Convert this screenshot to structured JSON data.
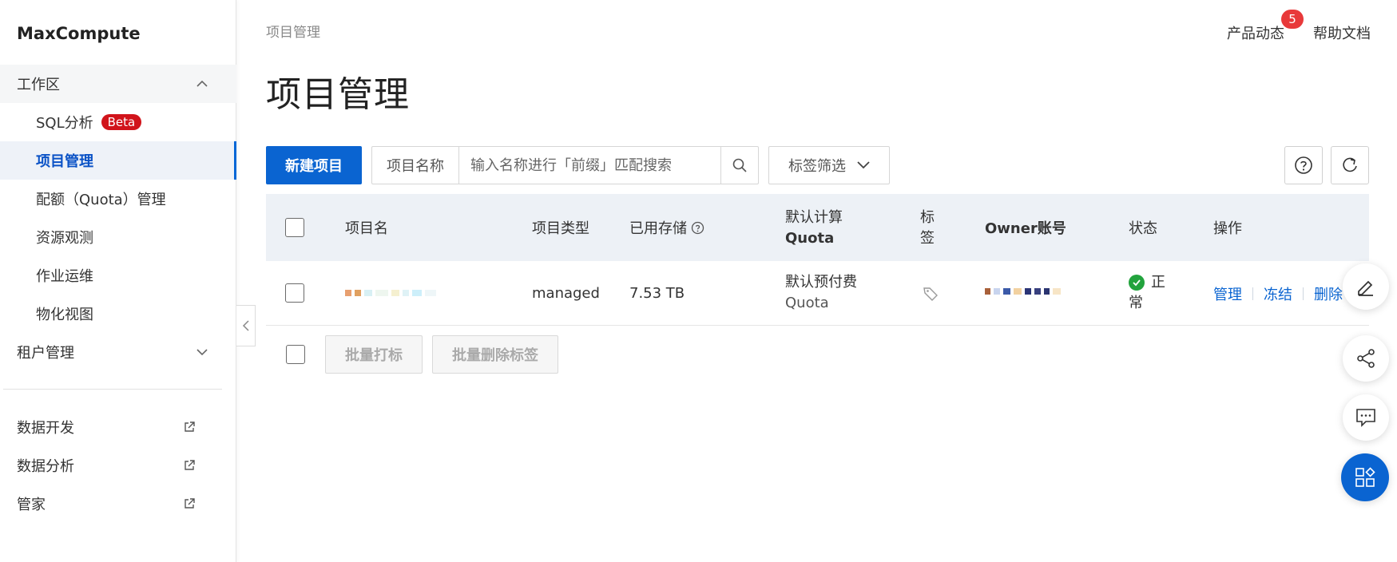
{
  "sidebar": {
    "brand": "MaxCompute",
    "workspace_group": "工作区",
    "items": [
      {
        "label": "SQL分析",
        "badge": "Beta"
      },
      {
        "label": "项目管理"
      },
      {
        "label": "配额（Quota）管理"
      },
      {
        "label": "资源观测"
      },
      {
        "label": "作业运维"
      },
      {
        "label": "物化视图"
      }
    ],
    "tenant_group": "租户管理",
    "external_links": [
      {
        "label": "数据开发"
      },
      {
        "label": "数据分析"
      },
      {
        "label": "管家"
      }
    ]
  },
  "header": {
    "breadcrumb": "项目管理",
    "news_label": "产品动态",
    "news_count": "5",
    "help_label": "帮助文档",
    "page_title": "项目管理"
  },
  "toolbar": {
    "new_project": "新建项目",
    "search_prefix": "项目名称",
    "search_placeholder": "输入名称进行「前缀」匹配搜索",
    "tag_filter": "标签筛选"
  },
  "table": {
    "headers": {
      "project_name": "项目名",
      "project_type": "项目类型",
      "used_storage": "已用存储",
      "default_quota_line1": "默认计算",
      "default_quota_line2": "Quota",
      "tags_line1": "标",
      "tags_line2": "签",
      "owner": "Owner账号",
      "status": "状态",
      "actions": "操作"
    },
    "rows": [
      {
        "type": "managed",
        "storage": "7.53 TB",
        "quota_line1": "默认预付费",
        "quota_line2": "Quota",
        "status_line1": "正",
        "status_line2": "常",
        "actions": [
          "管理",
          "冻结",
          "删除"
        ]
      }
    ]
  },
  "batch": {
    "tag_label": "批量打标",
    "delete_tags_label": "批量删除标签"
  },
  "colors": {
    "primary": "#0a64d1",
    "beta_badge": "#d1141b",
    "status_ok": "#22a33d",
    "header_bg": "#edf1f6"
  }
}
